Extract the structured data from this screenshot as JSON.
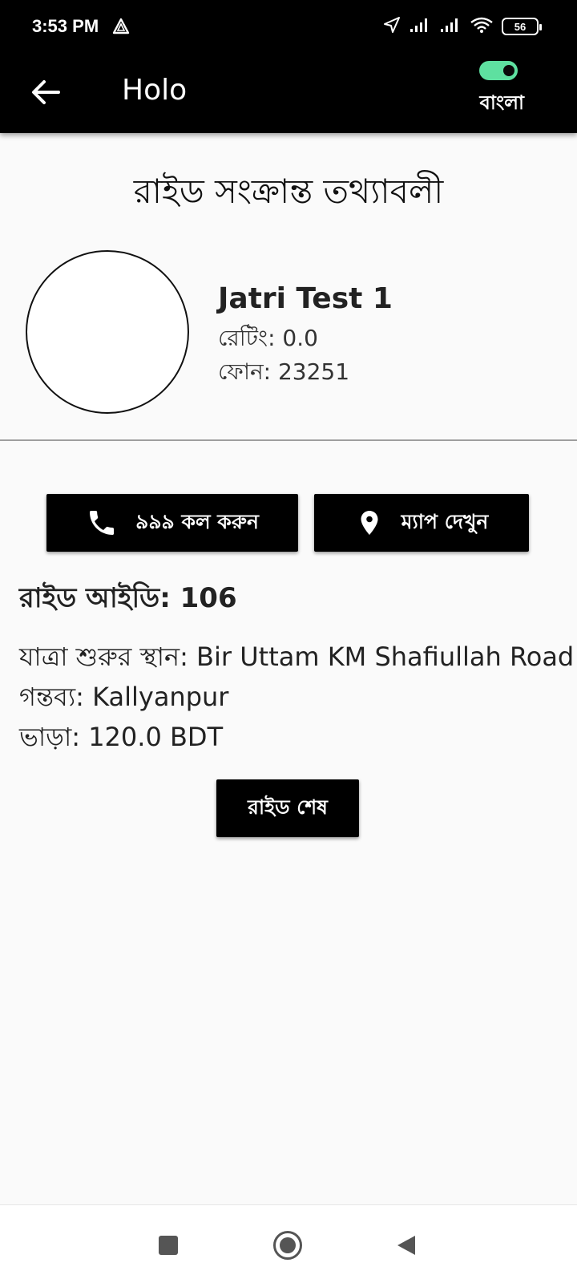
{
  "status_bar": {
    "time": "3:53 PM",
    "battery": "56",
    "icons": [
      "alert-triangle-icon",
      "location-arrow-icon",
      "signal-icon",
      "signal-icon",
      "wifi-icon",
      "battery-icon"
    ]
  },
  "app_bar": {
    "title": "Holo",
    "language_label": "বাংলা",
    "language_toggle_on": true,
    "toggle_color": "#5ee0a0"
  },
  "page": {
    "heading": "রাইড সংক্রান্ত তথ্যাবলী"
  },
  "driver": {
    "name": "Jatri Test 1",
    "rating": "রেটিং: 0.0",
    "phone": "ফোন: 23251"
  },
  "actions": {
    "call_label": "৯৯৯ কল করুন",
    "map_label": "ম্যাপ দেখুন",
    "end_label": "রাইড শেষ"
  },
  "ride": {
    "id_line": "রাইড আইডি: 106",
    "start_line": "যাত্রা শুরুর স্থান: Bir Uttam KM Shafiullah Road",
    "destination_line": "গন্তব্য: Kallyanpur",
    "fare_line": "ভাড়া: 120.0 BDT"
  },
  "nav_bar": {
    "icons": [
      "recents-square-icon",
      "home-circle-icon",
      "back-triangle-icon"
    ]
  }
}
